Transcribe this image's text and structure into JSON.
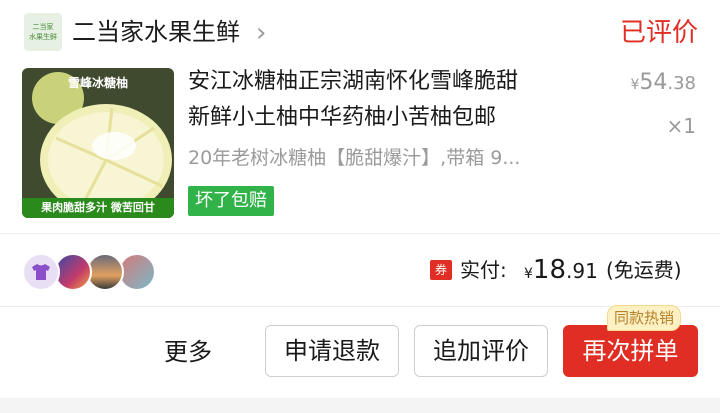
{
  "shop": {
    "logo_text": "二当家\n水果生鲜",
    "name": "二当家水果生鲜",
    "chevron": "›"
  },
  "order": {
    "status": "已评价",
    "product": {
      "thumb_title": "雪峰冰糖柚",
      "thumb_footer": "果肉脆甜多汁 微苦回甘",
      "title_line1": "安江冰糖柚正宗湖南怀化雪峰脆甜",
      "title_line2": "新鲜小土柚中华药柚小苦柚包邮",
      "spec": "20年老树冰糖柚【脆甜爆汁】,带箱 9...",
      "price_currency": "¥",
      "price_int": "54",
      "price_dec": ".38",
      "quantity": "×1",
      "guarantee_tag": "坏了包赔"
    },
    "payment": {
      "coupon_icon": "券",
      "label": "实付:",
      "currency": "¥",
      "amount_int": "18",
      "amount_dec": ".91",
      "shipping": "(免运费)"
    },
    "avatars": [
      "tshirt-avatar",
      "photo-avatar",
      "sunset-avatar",
      "cartoon-avatar"
    ]
  },
  "actions": {
    "more": "更多",
    "refund": "申请退款",
    "add_review": "追加评价",
    "rebuy": "再次拼单",
    "hot_badge": "同款热销"
  },
  "colors": {
    "accent_red": "#e02e24",
    "tag_green": "#32b34a",
    "badge_gold": "#b5812a"
  }
}
